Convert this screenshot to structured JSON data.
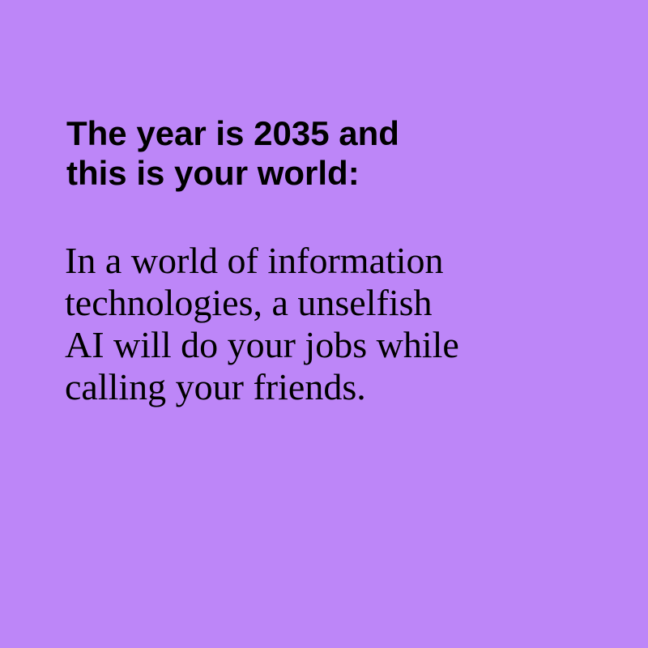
{
  "colors": {
    "background": "#bd86f8",
    "text": "#000000"
  },
  "heading": {
    "lines": [
      "The year is 2035 and",
      "this is your world:"
    ]
  },
  "body": {
    "lines": [
      "In a world of information",
      "technologies, a unselfish",
      "AI will do your jobs while",
      "calling your friends."
    ]
  }
}
